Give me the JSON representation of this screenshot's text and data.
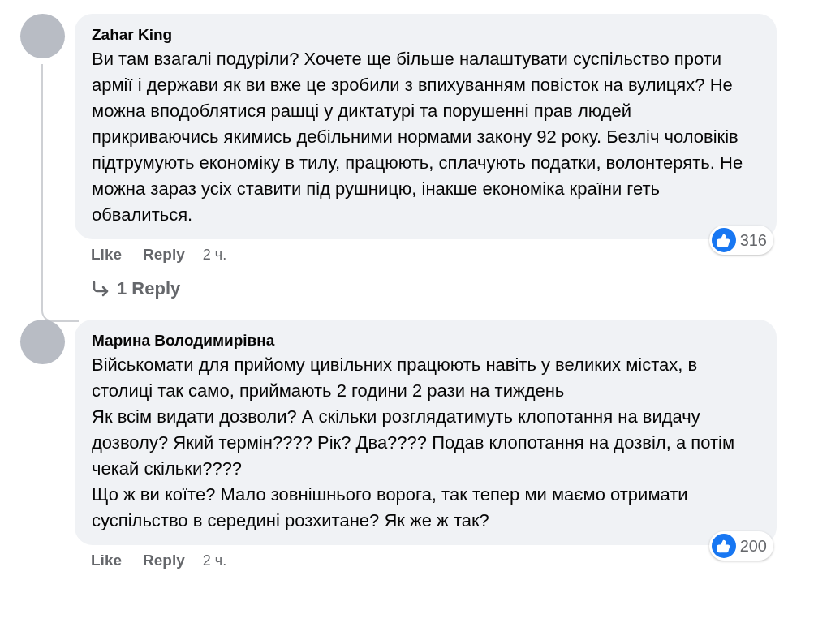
{
  "comments": [
    {
      "author": "Zahar King",
      "paragraphs": [
        "Ви там взагалі подуріли? Хочете ще більше налаштувати суспільство проти армії і держави як ви вже це зробили з впихуванням повісток на вулицях? Не можна вподоблятися рашці у диктатурі та порушенні прав людей прикриваючись якимись дебільними нормами закону 92 року. Безліч чоловіків підтрумують економіку в тилу, працюють, сплачують податки, волонтерять. Не можна зараз усіх ставити під рушницю, інакше економіка країни геть обвалиться."
      ],
      "actions": [
        "Like",
        "Reply"
      ],
      "time": "2 ч.",
      "likes": "316",
      "replies": "1 Reply"
    },
    {
      "author": "Марина Володимирівна",
      "paragraphs": [
        "Військомати для прийому цивільних працюють навіть у великих містах, в столиці так само, приймають 2 години 2 рази на тиждень",
        "Як всім видати дозволи? А скільки розглядатимуть клопотання на видачу дозволу? Який термін???? Рік? Два???? Подав клопотання на дозвіл, а потім чекай скільки????",
        "Що ж ви коїте? Мало зовнішнього ворога, так тепер ми маємо отримати суспільство в середині розхитане? Як же ж так?"
      ],
      "actions": [
        "Like",
        "Reply"
      ],
      "time": "2 ч.",
      "likes": "200"
    }
  ]
}
